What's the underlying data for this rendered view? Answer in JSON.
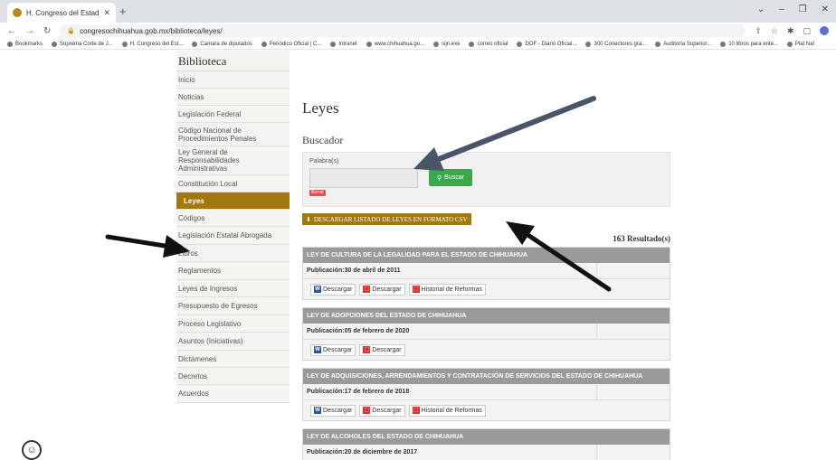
{
  "browser": {
    "tab_title": "H. Congreso del Estado de Chih...",
    "tab_close": "✕",
    "new_tab": "+",
    "url": "congresochihuahua.gob.mx/biblioteca/leyes/",
    "bookmarks": [
      "Bookmarks",
      "Suprema Corte de J...",
      "H. Congreso del Est...",
      "Camara de diputados",
      "Periódico Oficial | C...",
      "Intranet",
      "www.chihuahua.go...",
      "sijn.exe",
      "correo oficial",
      "DOF - Diario Oficial...",
      "300 Conectores gra...",
      "Auditoría Superior...",
      "10 libros para ente...",
      "Plat Nal"
    ]
  },
  "sidebar": {
    "title": "Biblioteca",
    "items": [
      {
        "label": "Inicio",
        "active": false
      },
      {
        "label": "Noticias",
        "active": false
      },
      {
        "label": "Legislación Federal",
        "active": false
      },
      {
        "label": "Código Nacional de Procedimientos Penales",
        "active": false
      },
      {
        "label": "Ley General de Responsabilidades Administrativas",
        "active": false
      },
      {
        "label": "Constitución Local",
        "active": false
      },
      {
        "label": "Leyes",
        "active": true
      },
      {
        "label": "Códigos",
        "active": false
      },
      {
        "label": "Legislación Estatal Abrogada",
        "active": false
      },
      {
        "label": "Libros",
        "active": false
      },
      {
        "label": "Reglamentos",
        "active": false
      },
      {
        "label": "Leyes de Ingresos",
        "active": false
      },
      {
        "label": "Presupuesto de Egresos",
        "active": false
      },
      {
        "label": "Proceso Legislativo",
        "active": false
      },
      {
        "label": "Asuntos (Iniciativas)",
        "active": false
      },
      {
        "label": "Dictámenes",
        "active": false
      },
      {
        "label": "Decretos",
        "active": false
      },
      {
        "label": "Acuerdos",
        "active": false
      }
    ]
  },
  "main": {
    "title": "Leyes",
    "search_title": "Buscador",
    "search_label": "Palabra(s)",
    "search_value": "",
    "search_button": "Buscar",
    "clear_button": "Borrar",
    "csv_button": "DESCARGAR LISTADO DE LEYES EN FORMATO CSV",
    "results": "163 Resultado(s)",
    "publication_prefix": "Publicación:",
    "laws": [
      {
        "name": "LEY DE CULTURA DE LA LEGALIDAD PARA EL ESTADO DE CHIHUAHUA",
        "date": "30 de abril de 2011",
        "buttons": [
          "Descargar",
          "Descargar",
          "Historial de Reformas"
        ]
      },
      {
        "name": "LEY DE ADOPCIONES DEL ESTADO DE CHIHUAHUA",
        "date": "05 de febrero de 2020",
        "buttons": [
          "Descargar",
          "Descargar"
        ]
      },
      {
        "name": "LEY DE ADQUISICIONES, ARRENDAMIENTOS Y CONTRATACIÓN DE SERVICIOS DEL ESTADO DE CHIHUAHUA",
        "date": "17 de febrero de 2018",
        "buttons": [
          "Descargar",
          "Descargar",
          "Historial de Reformas"
        ]
      },
      {
        "name": "LEY DE ALCOHOLES DEL ESTADO DE CHIHUAHUA",
        "date": "20 de diciembre de 2017",
        "buttons": []
      }
    ]
  },
  "colors": {
    "accent_gold": "#a0780b",
    "search_green": "#3aa84b",
    "law_header_gray": "#9a9a9a",
    "arrow_slate": "#4a5568",
    "arrow_black": "#111111"
  }
}
